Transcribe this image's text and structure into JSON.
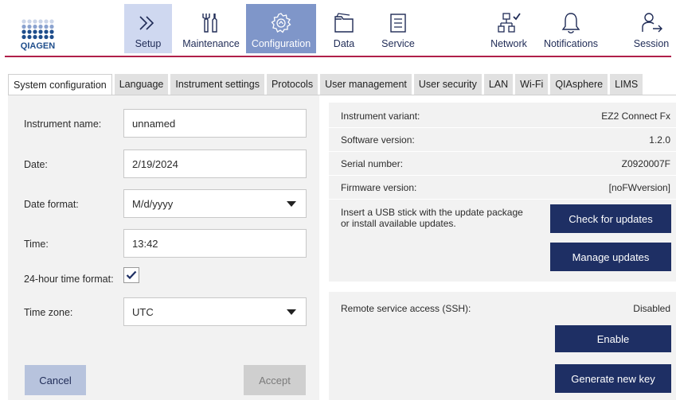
{
  "brand": {
    "logo_text": "QIAGEN"
  },
  "nav": {
    "setup": "Setup",
    "maintenance": "Maintenance",
    "configuration": "Configuration",
    "data": "Data",
    "service": "Service",
    "network": "Network",
    "notifications": "Notifications",
    "session": "Session"
  },
  "tabs": {
    "system_configuration": "System configuration",
    "language": "Language",
    "instrument_settings": "Instrument settings",
    "protocols": "Protocols",
    "user_management": "User management",
    "user_security": "User security",
    "lan": "LAN",
    "wifi": "Wi-Fi",
    "qiasphere": "QIAsphere",
    "lims": "LIMS"
  },
  "form": {
    "instrument_name_label": "Instrument name:",
    "instrument_name_value": "unnamed",
    "date_label": "Date:",
    "date_value": "2/19/2024",
    "date_format_label": "Date format:",
    "date_format_value": "M/d/yyyy",
    "time_label": "Time:",
    "time_value": "13:42",
    "hour24_label": "24-hour time format:",
    "hour24_checked": true,
    "timezone_label": "Time zone:",
    "timezone_value": "UTC",
    "cancel_label": "Cancel",
    "accept_label": "Accept"
  },
  "info": {
    "variant_label": "Instrument variant:",
    "variant_value": "EZ2 Connect Fx",
    "software_label": "Software version:",
    "software_value": "1.2.0",
    "serial_label": "Serial number:",
    "serial_value": "Z0920007F",
    "firmware_label": "Firmware version:",
    "firmware_value": "[noFWversion]",
    "update_note": "Insert a USB stick with the update package or install available updates.",
    "check_updates_label": "Check for updates",
    "manage_updates_label": "Manage updates"
  },
  "ssh": {
    "label": "Remote service access (SSH):",
    "status": "Disabled",
    "enable_label": "Enable",
    "generate_key_label": "Generate new key"
  },
  "colors": {
    "accent_dark": "#1e2f64",
    "nav_active": "#7f96c9",
    "nav_setup": "#cfd8f0",
    "brand_line": "#b01f4a",
    "logo_blue": "#1f4e8c"
  },
  "icons": {
    "setup": "double-chevron-right-icon",
    "maintenance": "tools-icon",
    "configuration": "gear-icon",
    "data": "folder-icon",
    "service": "document-list-icon",
    "network": "network-icon",
    "notifications": "bell-icon",
    "session": "user-logout-icon",
    "checkbox": "checkmark-icon",
    "dropdown": "caret-down-icon"
  }
}
